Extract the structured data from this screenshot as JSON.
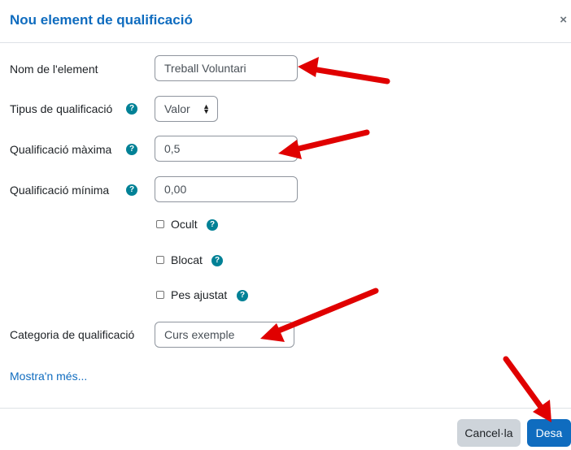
{
  "dialog": {
    "title": "Nou element de qualificació",
    "close_glyph": "×"
  },
  "form": {
    "name": {
      "label": "Nom de l'element",
      "value": "Treball Voluntari"
    },
    "grade_type": {
      "label": "Tipus de qualificació",
      "value": "Valor",
      "help_icon": "question-circle-icon"
    },
    "max_grade": {
      "label": "Qualificació màxima",
      "value": "0,5",
      "help_icon": "question-circle-icon"
    },
    "min_grade": {
      "label": "Qualificació mínima",
      "value": "0,00",
      "help_icon": "question-circle-icon"
    },
    "hidden": {
      "label": "Ocult",
      "checked": false
    },
    "locked": {
      "label": "Blocat",
      "checked": false
    },
    "weight_adjusted": {
      "label": "Pes ajustat",
      "checked": false
    },
    "category": {
      "label": "Categoria de qualificació",
      "value": "Curs exemple"
    },
    "show_more": "Mostra'n més..."
  },
  "footer": {
    "cancel_label": "Cancel·la",
    "save_label": "Desa"
  },
  "colors": {
    "accent": "#0f6cbf",
    "help": "#008196",
    "annotation_arrow": "#e00000"
  }
}
